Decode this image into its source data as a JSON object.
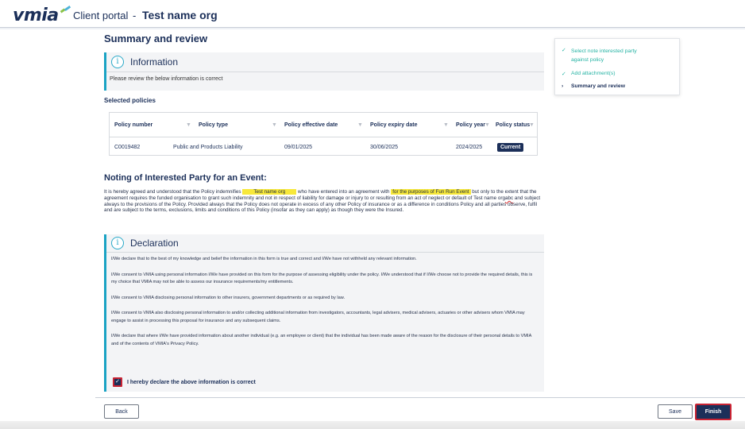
{
  "header": {
    "logo": "vmia",
    "portal_label": "Client portal",
    "separator": "-",
    "org_name": "Test name org"
  },
  "main": {
    "heading": "Summary and review",
    "info_panel": {
      "title": "Information",
      "text": "Please review the below information is correct"
    },
    "selected_policies_label": "Selected policies",
    "policy_table": {
      "columns": [
        "Policy number",
        "Policy type",
        "Policy effective date",
        "Policy expiry date",
        "Policy year",
        "Policy status"
      ],
      "rows": [
        {
          "policy_number": "C0019482",
          "policy_type": "Public and Products Liability",
          "effective_date": "09/01/2025",
          "expiry_date": "30/06/2025",
          "policy_year": "2024/2025",
          "status": "Current"
        }
      ]
    },
    "noting": {
      "title": "Noting of Interested Party for an Event:",
      "p1": "It is hereby agreed and understood that the Policy indemnifies",
      "org_highlight": "Test name org",
      "p2": "who have entered into an agreement with",
      "purpose_highlight": "for the purposes of Fun Run Event",
      "p3": "but only to the extent that the agreement requires the funded organisation to grant such indemnity and not in respect of liability for damage or injury to or resulting from an act of neglect or default of",
      "inline_org": "Test name org",
      "inline_abc": "abc",
      "p4": "and subject always to the provisions of the Policy. Provided always that the Policy does not operate in excess of any other Policy of insurance or as a difference in conditions Policy and all parties observe, fulfil and are subject to the terms, exclusions, limits and conditions of this Policy (insofar as they can apply) as though they were the Insured."
    },
    "declaration": {
      "title": "Declaration",
      "paragraphs": [
        "I/We declare that to the best of my knowledge and belief the information in this form is true and correct and I/We have not withheld any relevant information.",
        "I/We consent to VMIA using personal information I/We have provided on this form for the purpose of assessing eligibility under the policy. I/We understood that if I/We choose not to provide the required details, this is my choice that VMIA may not be able to assess our insurance requirements/my entitlements.",
        "I/We consent to VMIA disclosing personal information to other insurers, government departments or as required by law.",
        "I/We consent to VMIA also disclosing personal information to and/or collecting additional information from investigators, accountants, legal advisers, medical advisers, actuaries or other advisers whom VMIA may engage to assist in processing this proposal for insurance and any subsequent claims.",
        "I/We declare that where I/We have provided information about another individual (e.g. an employee or client) that the individual has been made aware of the reason for the disclosure of their personal details to VMIA and of the contents of VMIA's Privacy Policy."
      ],
      "checkbox_label": "I hereby declare the above information is correct",
      "checked": true
    }
  },
  "stepper": {
    "steps": [
      {
        "line1": "Select note interested party",
        "line2": "against policy",
        "state": "done"
      },
      {
        "line1": "Add attachment(s)",
        "line2": "",
        "state": "done"
      },
      {
        "line1": "Summary and review",
        "line2": "",
        "state": "current"
      }
    ]
  },
  "footer": {
    "back_label": "Back",
    "save_label": "Save",
    "finish_label": "Finish"
  },
  "colors": {
    "brand_navy": "#1b2f59",
    "accent_teal": "#1aa3c4",
    "done_green": "#26b3a4",
    "highlight_yellow": "#f7e83a",
    "focus_red": "#c82333"
  }
}
